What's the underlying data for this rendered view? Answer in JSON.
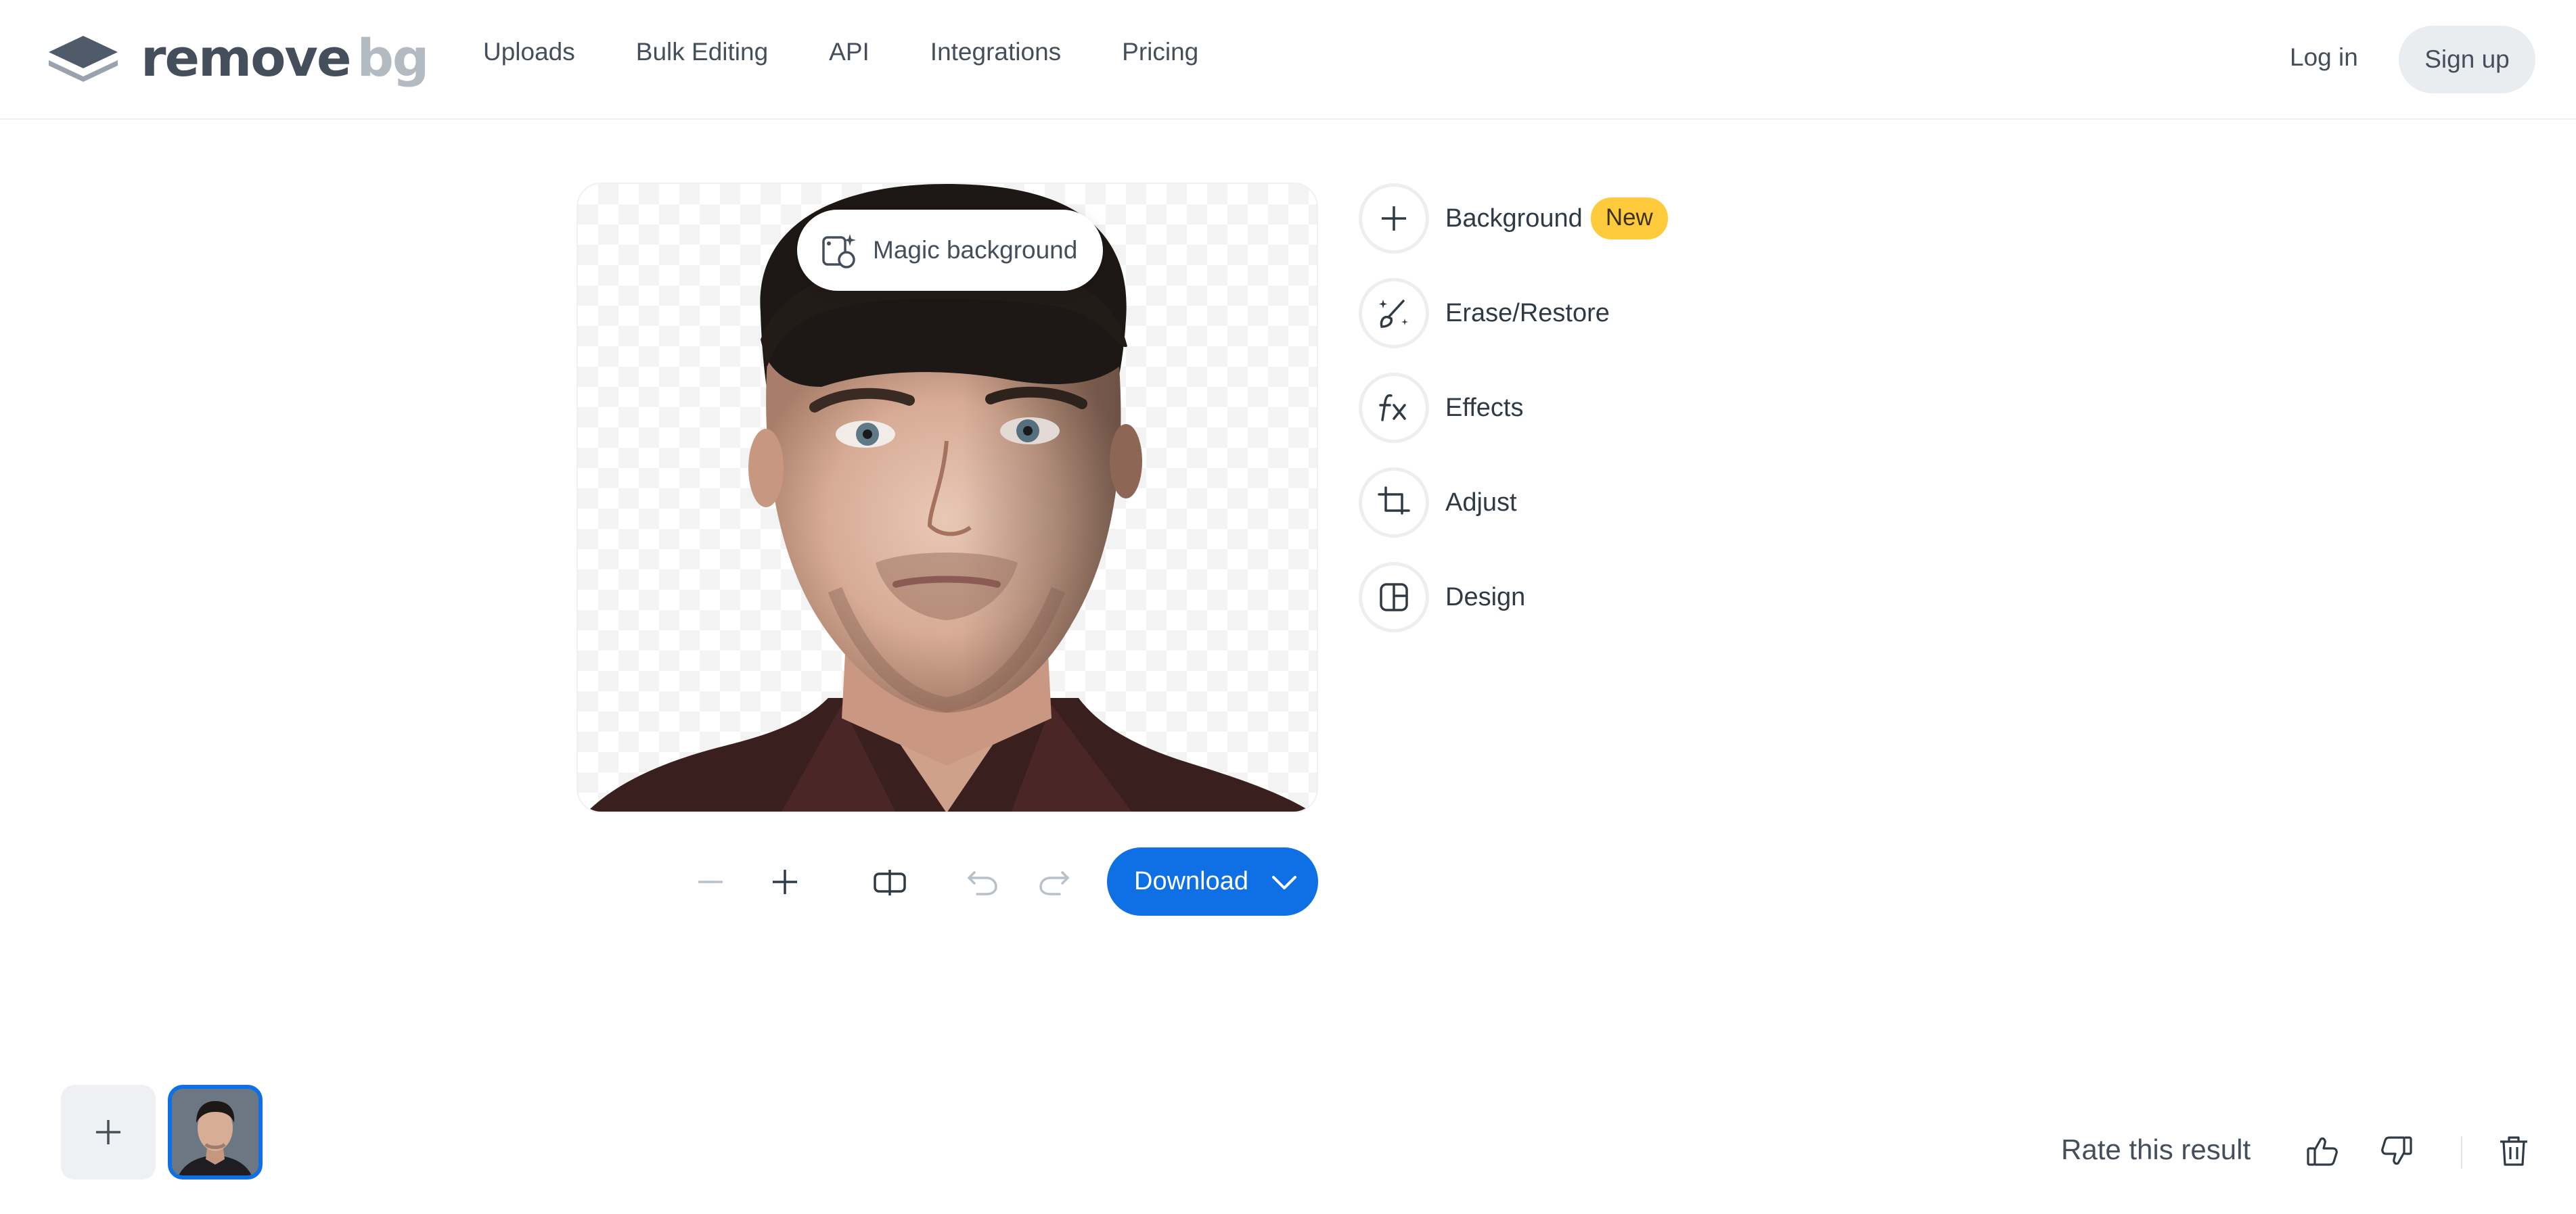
{
  "header": {
    "logo_remove": "remove",
    "logo_bg": "bg",
    "nav": [
      {
        "label": "Uploads"
      },
      {
        "label": "Bulk Editing"
      },
      {
        "label": "API"
      },
      {
        "label": "Integrations"
      },
      {
        "label": "Pricing"
      }
    ],
    "login": "Log in",
    "signup": "Sign up"
  },
  "canvas": {
    "magic_background": "Magic background",
    "image_alt": "Portrait with removed background"
  },
  "tools": [
    {
      "label": "Background",
      "icon": "plus-icon",
      "badge": "New"
    },
    {
      "label": "Erase/Restore",
      "icon": "magic-brush-icon"
    },
    {
      "label": "Effects",
      "icon": "fx-icon"
    },
    {
      "label": "Adjust",
      "icon": "crop-icon"
    },
    {
      "label": "Design",
      "icon": "layout-icon"
    }
  ],
  "toolbar": {
    "download_label": "Download"
  },
  "footer": {
    "rate_label": "Rate this result"
  },
  "colors": {
    "accent": "#0f70e6",
    "badge": "#ffcb3d",
    "text": "#454f5b"
  }
}
